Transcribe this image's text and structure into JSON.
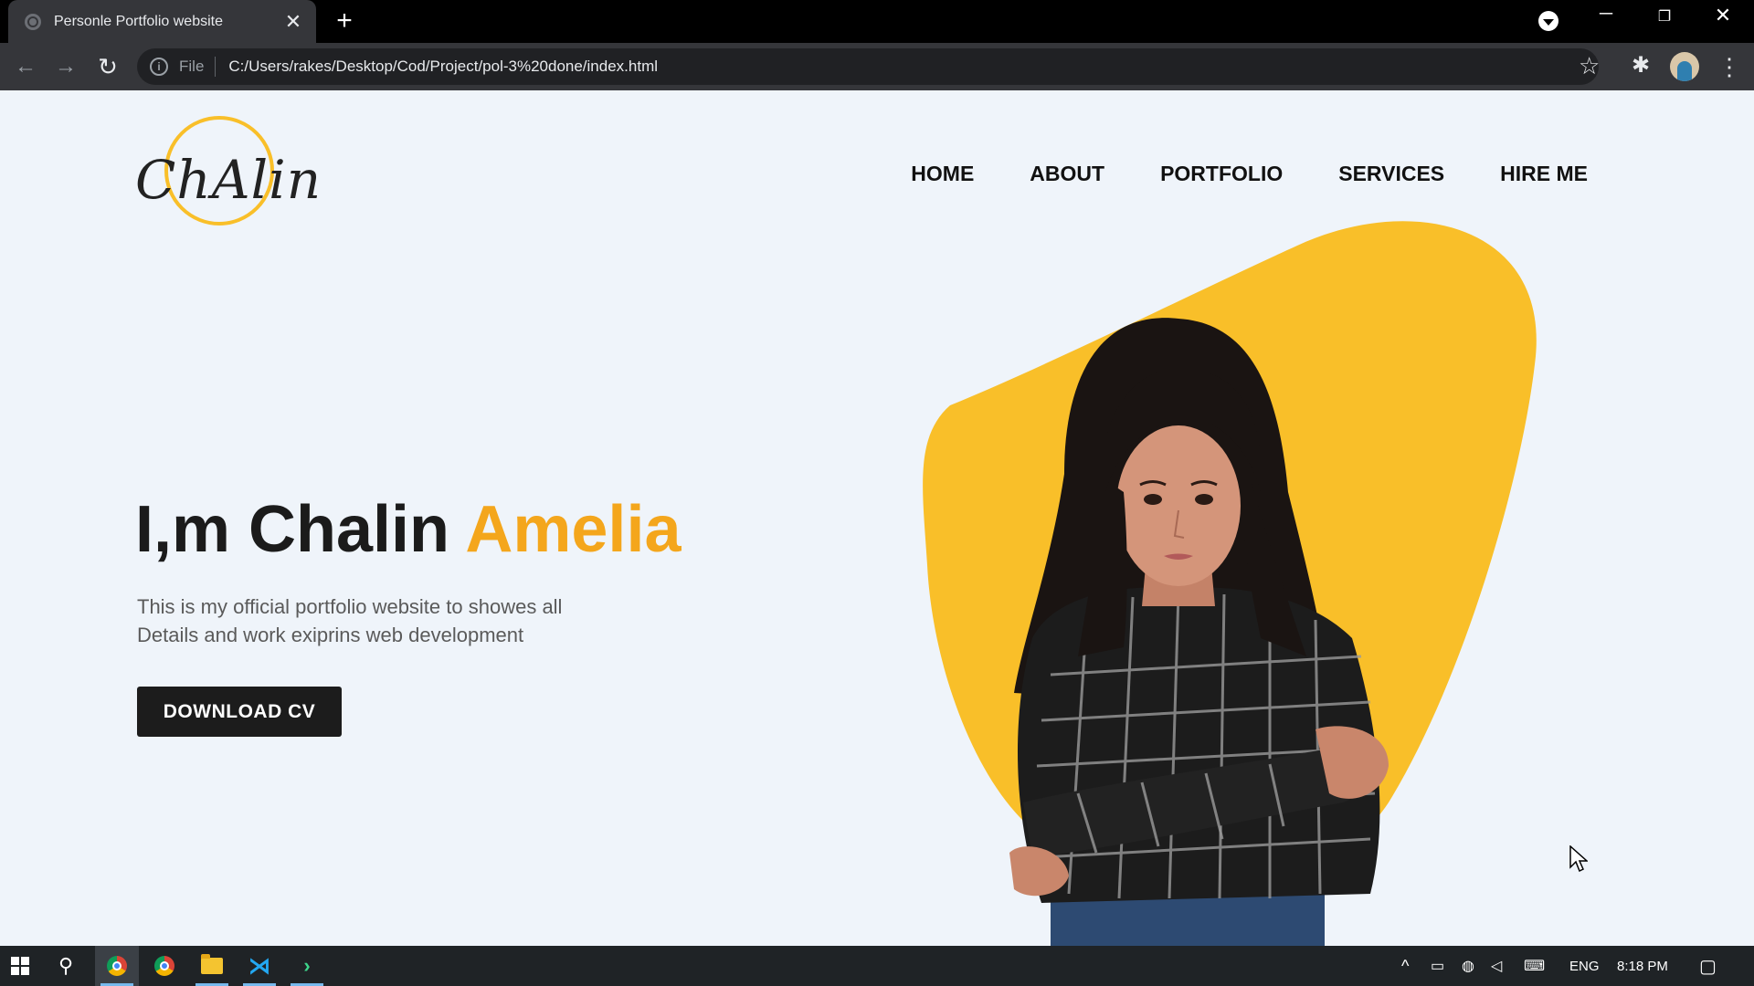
{
  "browser": {
    "tab_title": "Personle Portfolio website",
    "tab_close": "✕",
    "new_tab": "+",
    "scheme": "File",
    "url": "C:/Users/rakes/Desktop/Cod/Project/pol-3%20done/index.html"
  },
  "site": {
    "logo_text": "ChAlin",
    "nav": [
      "HOME",
      "ABOUT",
      "PORTFOLIO",
      "SERVICES",
      "HIRE ME"
    ],
    "headline_main": "I,m Chalin ",
    "headline_accent": "Amelia",
    "description_line1": "This is my official portfolio website to showes all",
    "description_line2": "Details and work exiprins web development",
    "cv_button": "DOWNLOAD CV",
    "accent_color": "#f4a61c",
    "blob_color": "#f9bf29"
  },
  "taskbar": {
    "language": "ENG",
    "time": "8:18 PM"
  }
}
